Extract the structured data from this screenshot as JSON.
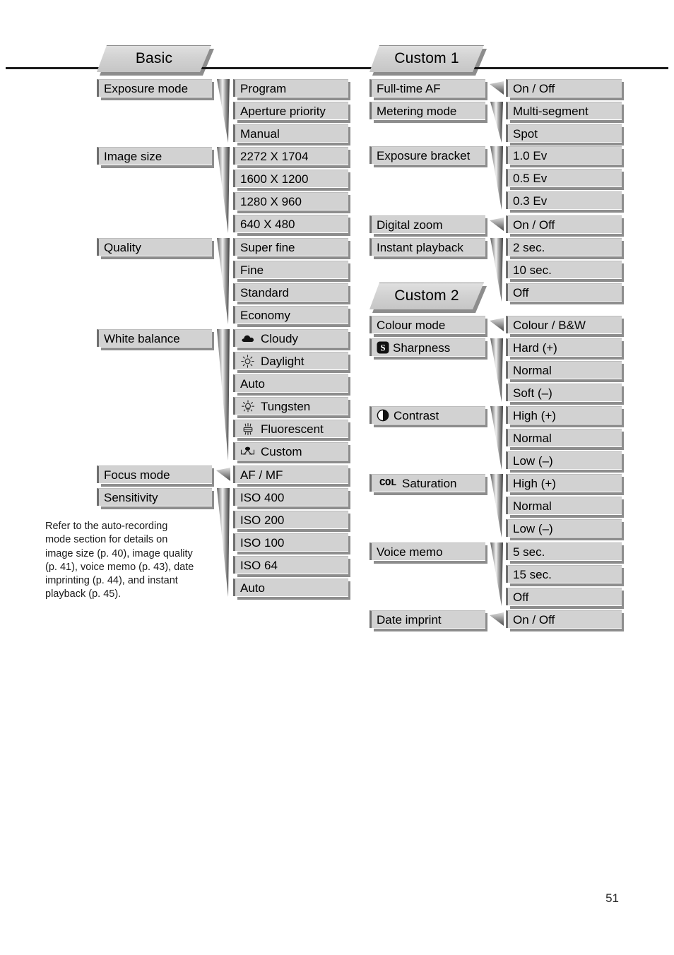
{
  "page": {
    "number": "51",
    "footnote": "Refer to the auto-recording\nmode section for details on\nimage size (p. 40), image quality\n(p. 41), voice memo (p. 43), date\nimprinting (p. 44), and instant\nplayback (p. 45)."
  },
  "colors": {
    "box_fill": "#d2d2d2",
    "box_border": "#6f6f6f",
    "shadow": "#8d8d8d",
    "rule": "#1b1b1b",
    "text": "#000000"
  },
  "tabs": [
    {
      "label": "Basic"
    },
    {
      "label": "Custom 1"
    },
    {
      "label": "Custom 2"
    }
  ],
  "columns": {
    "left": {
      "tab": "Basic",
      "groups": [
        {
          "name": "exposure-mode",
          "label": "Exposure mode",
          "options": [
            {
              "label": "Program"
            },
            {
              "label": "Aperture priority"
            },
            {
              "label": "Manual"
            }
          ]
        },
        {
          "name": "image-size",
          "label": "Image size",
          "options": [
            {
              "label": "2272 X 1704"
            },
            {
              "label": "1600 X 1200"
            },
            {
              "label": "1280 X 960"
            },
            {
              "label": "640 X 480"
            }
          ]
        },
        {
          "name": "quality",
          "label": "Quality",
          "options": [
            {
              "label": "Super fine"
            },
            {
              "label": "Fine"
            },
            {
              "label": "Standard"
            },
            {
              "label": "Economy"
            }
          ]
        },
        {
          "name": "white-balance",
          "label": "White balance",
          "options": [
            {
              "label": "Cloudy",
              "icon": "cloudy-icon"
            },
            {
              "label": "Daylight",
              "icon": "daylight-icon"
            },
            {
              "label": "Auto"
            },
            {
              "label": "Tungsten",
              "icon": "tungsten-icon"
            },
            {
              "label": "Fluorescent",
              "icon": "fluorescent-icon"
            },
            {
              "label": "Custom",
              "icon": "custom-wb-icon"
            }
          ]
        },
        {
          "name": "focus-mode",
          "label": "Focus mode",
          "options": [
            {
              "label": "AF / MF"
            }
          ]
        },
        {
          "name": "sensitivity",
          "label": "Sensitivity",
          "options": [
            {
              "label": "ISO 400"
            },
            {
              "label": "ISO 200"
            },
            {
              "label": "ISO 100"
            },
            {
              "label": "ISO 64"
            },
            {
              "label": "Auto"
            }
          ]
        }
      ]
    },
    "right": {
      "tab1": "Custom 1",
      "tab2": "Custom 2",
      "groups": [
        {
          "name": "full-time-af",
          "label": "Full-time AF",
          "options": [
            {
              "label": "On / Off"
            }
          ]
        },
        {
          "name": "metering-mode",
          "label": "Metering mode",
          "options": [
            {
              "label": "Multi-segment"
            },
            {
              "label": "Spot"
            }
          ]
        },
        {
          "name": "exposure-bracket",
          "label": "Exposure bracket",
          "options": [
            {
              "label": "1.0 Ev"
            },
            {
              "label": "0.5 Ev"
            },
            {
              "label": "0.3 Ev"
            }
          ]
        },
        {
          "name": "digital-zoom",
          "label": "Digital zoom",
          "options": [
            {
              "label": "On / Off"
            }
          ]
        },
        {
          "name": "instant-playback",
          "label": "Instant playback",
          "options": [
            {
              "label": "2 sec."
            },
            {
              "label": "10 sec."
            },
            {
              "label": "Off"
            }
          ]
        },
        {
          "name": "colour-mode",
          "label": "Colour mode",
          "options": [
            {
              "label": "Colour / B&W"
            }
          ]
        },
        {
          "name": "sharpness",
          "label": "Sharpness",
          "icon": "sharpness-icon",
          "options": [
            {
              "label": "Hard (+)"
            },
            {
              "label": "Normal"
            },
            {
              "label": "Soft (–)"
            }
          ]
        },
        {
          "name": "contrast",
          "label": "Contrast",
          "icon": "contrast-icon",
          "options": [
            {
              "label": "High (+)"
            },
            {
              "label": "Normal"
            },
            {
              "label": "Low (–)"
            }
          ]
        },
        {
          "name": "saturation",
          "label": "Saturation",
          "icon": "col-icon",
          "icon_text": "COL",
          "options": [
            {
              "label": "High (+)"
            },
            {
              "label": "Normal"
            },
            {
              "label": "Low (–)"
            }
          ]
        },
        {
          "name": "voice-memo",
          "label": "Voice memo",
          "options": [
            {
              "label": "5 sec."
            },
            {
              "label": "15 sec."
            },
            {
              "label": "Off"
            }
          ]
        },
        {
          "name": "date-imprint",
          "label": "Date imprint",
          "options": [
            {
              "label": "On / Off"
            }
          ]
        }
      ]
    }
  }
}
